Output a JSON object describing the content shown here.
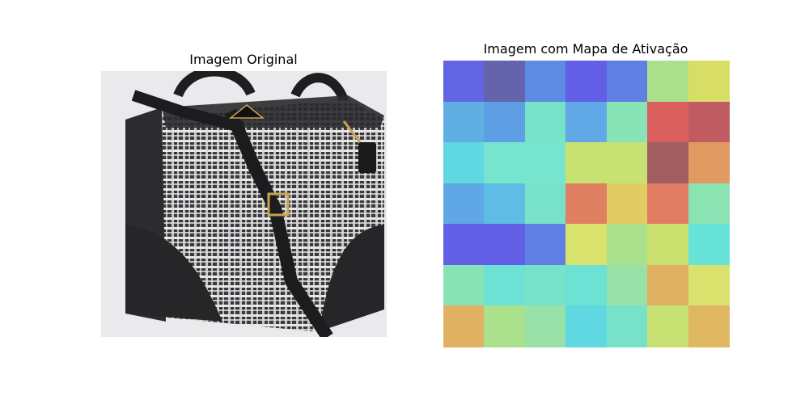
{
  "figure": {
    "left_title": "Imagem Original",
    "right_title": "Imagem com Mapa de Ativação"
  },
  "heatmap": {
    "rows": 7,
    "cols": 7,
    "colors": [
      [
        "#6364e2",
        "#6463ac",
        "#5d8ae3",
        "#625ee6",
        "#5f7fe3",
        "#abe18d",
        "#d8de65"
      ],
      [
        "#5fafe2",
        "#5e9ee4",
        "#77e2c7",
        "#61a9e6",
        "#87e2b5",
        "#d95e5d",
        "#c05b62"
      ],
      [
        "#5fd8e2",
        "#77e4ce",
        "#77e4ce",
        "#c7e173",
        "#c7e173",
        "#a15e61",
        "#e09a62"
      ],
      [
        "#5fa7e5",
        "#5fbce4",
        "#77e2c7",
        "#e08062",
        "#e2cb63",
        "#e17d63",
        "#8be3b3"
      ],
      [
        "#625ee6",
        "#625ee6",
        "#5f7fe3",
        "#d8e26c",
        "#abe18d",
        "#cbe16f",
        "#67e2d7"
      ],
      [
        "#87e2b5",
        "#6be2d3",
        "#77e2c7",
        "#6be2d3",
        "#98e1a8",
        "#e0b163",
        "#d8e26c"
      ],
      [
        "#e0b163",
        "#abe18d",
        "#98e1a8",
        "#5fd8e2",
        "#77e2c7",
        "#c7e173",
        "#e0b864"
      ]
    ]
  }
}
